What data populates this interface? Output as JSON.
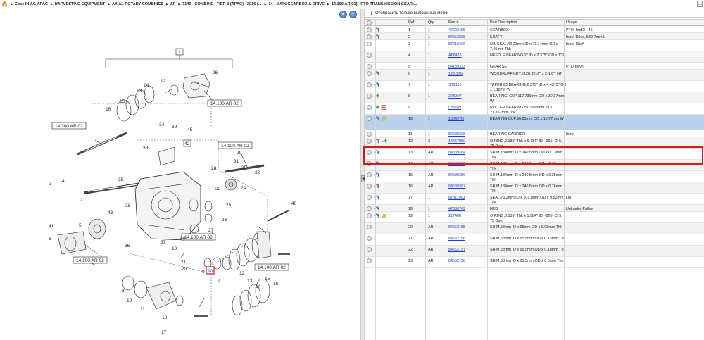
{
  "breadcrumb": {
    "items": [
      "Case IH AG APAC",
      "HARVESTING EQUIPMENT",
      "AXIAL ROTARY COMBINES",
      "AF",
      "7140 - COMBINE - TIER 3 (APAC) - 2016 (...",
      "14 - MAIN GEARBOX & DRIVE",
      "14.100.AR[01] - PTO TRANSMISSION GEAR;..."
    ]
  },
  "filter": {
    "label": "Отобразить только выбранные метки"
  },
  "columns": {
    "ref": "Ref",
    "qty": "Qty",
    "part": "Part #",
    "desc": "Part Description",
    "usage": "Usage"
  },
  "rows": [
    {
      "ref": "1",
      "qty": "1",
      "part": "47692495",
      "desc": "GEARBOX",
      "usage": "PTO, Incl 2 - 46",
      "icons": "ci"
    },
    {
      "ref": "2",
      "qty": "1",
      "part": "84552838",
      "desc": "SHAFT",
      "usage": "Input Drive, 539.7mm L",
      "icons": "ci"
    },
    {
      "ref": "3",
      "qty": "1",
      "part": "87618406",
      "desc": "OIL SEAL,49.23mm ID x 73.14mm OD x 7.95mm Thk",
      "usage": "Input Shaft",
      "icons": "c"
    },
    {
      "ref": "4",
      "qty": "1",
      "part": "A66476",
      "desc": "NEEDLE BEARING,2\" ID x 2.375\" OD x 1\" L",
      "usage": "",
      "icons": "c"
    },
    {
      "ref": "5",
      "qty": "1",
      "part": "84139333",
      "desc": "GEAR SET",
      "usage": "PTO Bevel",
      "icons": "c"
    },
    {
      "ref": "6",
      "qty": "1",
      "part": "126-176",
      "desc": "WOODRUFF KEY,#128, 5/16\" x 2-1/8\", HT",
      "usage": "",
      "icons": "ci"
    },
    {
      "ref": "7",
      "qty": "1",
      "part": "ST2116",
      "desc": "TAPERED BEARING,2.375\" ID x 4.4375\" OD x 1.1875\" W",
      "usage": "",
      "icons": "ci"
    },
    {
      "ref": "8",
      "qty": "1",
      "part": "22396V",
      "desc": "BEARING, CUP,112.739mm OD x 30.37mm W",
      "usage": "",
      "icons": "ca"
    },
    {
      "ref": "9",
      "qty": "1",
      "part": "L33289",
      "desc": "ROLLER BEARING,57.1565mm ID x 21.857mm Thk",
      "usage": "",
      "icons": "can"
    },
    {
      "ref": "10",
      "qty": "1",
      "part": "105497H",
      "desc": "BEARING CUP,96.85mm OD x 15.77mm W",
      "usage": "",
      "icons": "cie"
    },
    {
      "ref": "11",
      "qty": "1",
      "part": "84589398",
      "desc": "BEARING CARRIER",
      "usage": "Input",
      "icons": "c"
    },
    {
      "ref": "12",
      "qty": "3",
      "part": "14467980",
      "desc": "O-RING,0.139\" Thk x 6.734\" ID, -261, Cl 5, 75 Duro",
      "usage": "",
      "icons": "cia"
    },
    {
      "ref": "13",
      "qty": "AR",
      "part": "84589384",
      "desc": "SHIM,184mm ID x 240.5mm OD x 0.13mm Thk",
      "usage": "",
      "icons": "ci"
    },
    {
      "ref": "14",
      "qty": "AR",
      "part": "84589385",
      "desc": "SHIM,184mm ID x 240.5mm OD x 0.18mm Thk",
      "usage": "",
      "icons": "ci"
    },
    {
      "ref": "15",
      "qty": "AR",
      "part": "84589386",
      "desc": "SHIM,184mm ID x 240.5mm OD x 0.25mm Thk",
      "usage": "",
      "icons": "ci"
    },
    {
      "ref": "16",
      "qty": "AR",
      "part": "84589387",
      "desc": "SHIM,184mm ID x 240.5mm OD x 0.76mm Thk",
      "usage": "",
      "icons": "ci"
    },
    {
      "ref": "17",
      "qty": "1",
      "part": "87311003",
      "desc": "SEAL,76.2mm ID x 101.8mm OD x 9.53mm Thk",
      "usage": "Lip",
      "icons": "ci"
    },
    {
      "ref": "18",
      "qty": "1",
      "part": "47630749",
      "desc": "HUB",
      "usage": "Unloader Pulley",
      "icons": "ci"
    },
    {
      "ref": "19",
      "qty": "1",
      "part": "217408",
      "desc": "O-RING,0.139\" Thk x 1.984\" ID, -226, Cl 5, 75 Duro",
      "usage": "",
      "icons": "cie"
    },
    {
      "ref": "20",
      "qty": "AR",
      "part": "84552155",
      "desc": "SHIM,58mm ID x 65mm OD x 0.08mm Thk",
      "usage": "",
      "icons": "c"
    },
    {
      "ref": "21",
      "qty": "AR",
      "part": "84552156",
      "desc": "SHIM,58mm ID x 65.5mm OD x 0.13mm Thk",
      "usage": "",
      "icons": "c"
    },
    {
      "ref": "22",
      "qty": "AR",
      "part": "84552157",
      "desc": "SHIM,58mm ID x 65.5mm OD x 0.18mm Thk",
      "usage": "",
      "icons": "c"
    },
    {
      "ref": "23",
      "qty": "AR",
      "part": "84552158",
      "desc": "SHIM,58mm ID x 65.5mm OD x 0.5mm Thk",
      "usage": "",
      "icons": "c"
    }
  ],
  "diagram": {
    "callout_boxes": [
      "1",
      "14.100.AR 02",
      "14.100.AR 02",
      "14.100.AR 02",
      "14.100.AR 02",
      "14.100.AR 02",
      "14.100.AR 02",
      "42"
    ],
    "labels": [
      "26",
      "14",
      "13",
      "12",
      "15",
      "16",
      "34",
      "39",
      "45",
      "33",
      "29",
      "31",
      "30",
      "32",
      "28",
      "22",
      "24",
      "25",
      "23",
      "27",
      "35",
      "38",
      "43",
      "3",
      "4",
      "2",
      "37",
      "36",
      "44",
      "41",
      "5",
      "6",
      "20",
      "21",
      "9",
      "8",
      "10",
      "7",
      "19",
      "17",
      "11",
      "18",
      "40",
      "12",
      "13",
      "14",
      "15",
      "16"
    ],
    "highlighted_label": "10"
  },
  "colors": {
    "link": "#1a3fd6",
    "selected_row": "#b9d1ea",
    "highlight_border": "#d61a1a"
  }
}
